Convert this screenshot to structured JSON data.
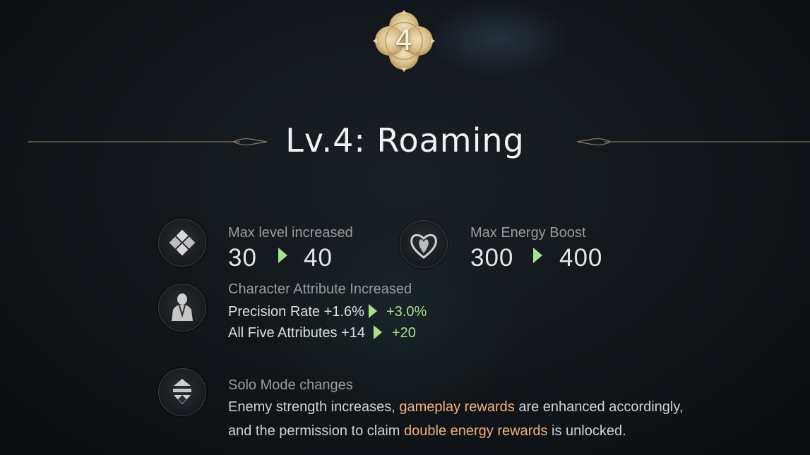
{
  "badge": {
    "number": "4"
  },
  "title": "Lv.4: Roaming",
  "stats": {
    "max_level": {
      "label": "Max level increased",
      "from": "30",
      "to": "40"
    },
    "max_energy": {
      "label": "Max Energy Boost",
      "from": "300",
      "to": "400"
    }
  },
  "attributes": {
    "label": "Character Attribute Increased",
    "rows": [
      {
        "text": "Precision Rate +1.6%",
        "new": "+3.0%"
      },
      {
        "text": "All Five Attributes +14",
        "new": "+20"
      }
    ]
  },
  "solo": {
    "label": "Solo Mode changes",
    "parts": {
      "p1": "Enemy strength increases, ",
      "hl1": "gameplay rewards",
      "p2": " are enhanced accordingly, and the permission to claim ",
      "hl2": "double energy rewards",
      "p3": " is unlocked."
    }
  },
  "colors": {
    "accent_green": "#a8e08c",
    "highlight_orange": "#f0b37c",
    "badge_gold": "#e6d3a4"
  },
  "icons": {
    "badge": "quatrefoil-badge",
    "max_level": "diamond-icon",
    "energy": "heart-emblem-icon",
    "character": "character-silhouette-icon",
    "solo": "solo-mode-icon"
  }
}
